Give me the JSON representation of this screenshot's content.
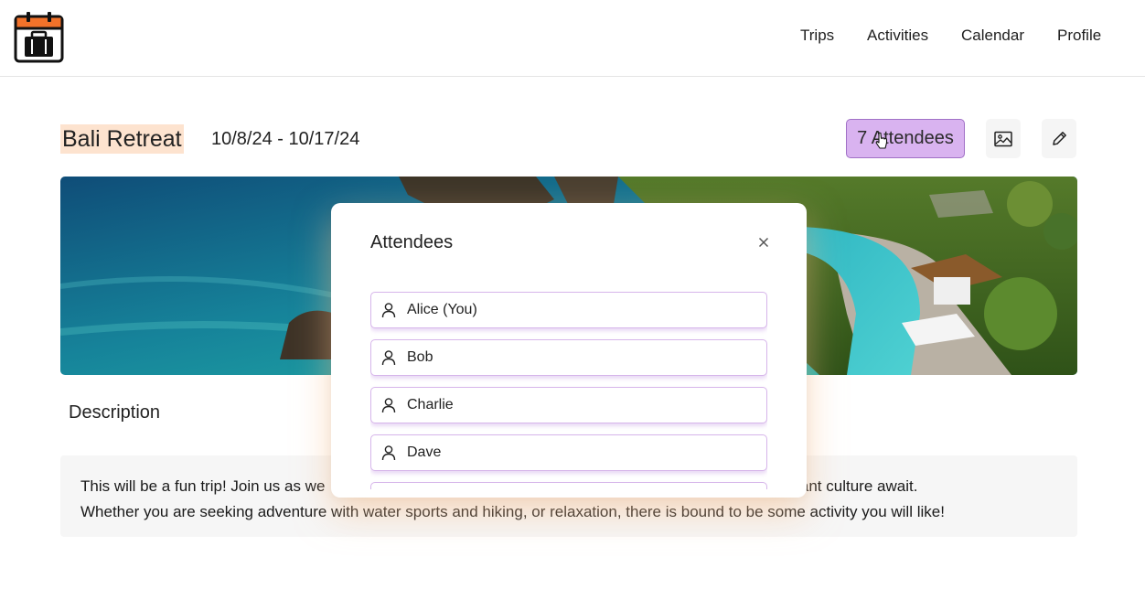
{
  "nav": {
    "links": [
      "Trips",
      "Activities",
      "Calendar",
      "Profile"
    ]
  },
  "trip": {
    "title": "Bali Retreat",
    "dates": "10/8/24 - 10/17/24",
    "attendees_label": "7 Attendees",
    "attendee_count": 7
  },
  "description": {
    "heading": "Description",
    "line1_visible": "This will be a fun trip! Join us as we",
    "line1_tail": "races, and vibrant culture await.",
    "line2": "Whether you are seeking adventure with water sports and hiking, or relaxation, there is bound to be some activity you will like!"
  },
  "modal": {
    "title": "Attendees",
    "close_symbol": "×",
    "attendees": [
      "Alice (You)",
      "Bob",
      "Charlie",
      "Dave"
    ]
  },
  "icons": {
    "logo": "suitcase-calendar-icon",
    "image": "image-icon",
    "edit": "pencil-icon",
    "person": "person-icon",
    "close": "close-icon"
  },
  "colors": {
    "accent_purple": "#d9b3f0",
    "title_highlight": "#fde3cf",
    "logo_orange": "#f2722a"
  }
}
